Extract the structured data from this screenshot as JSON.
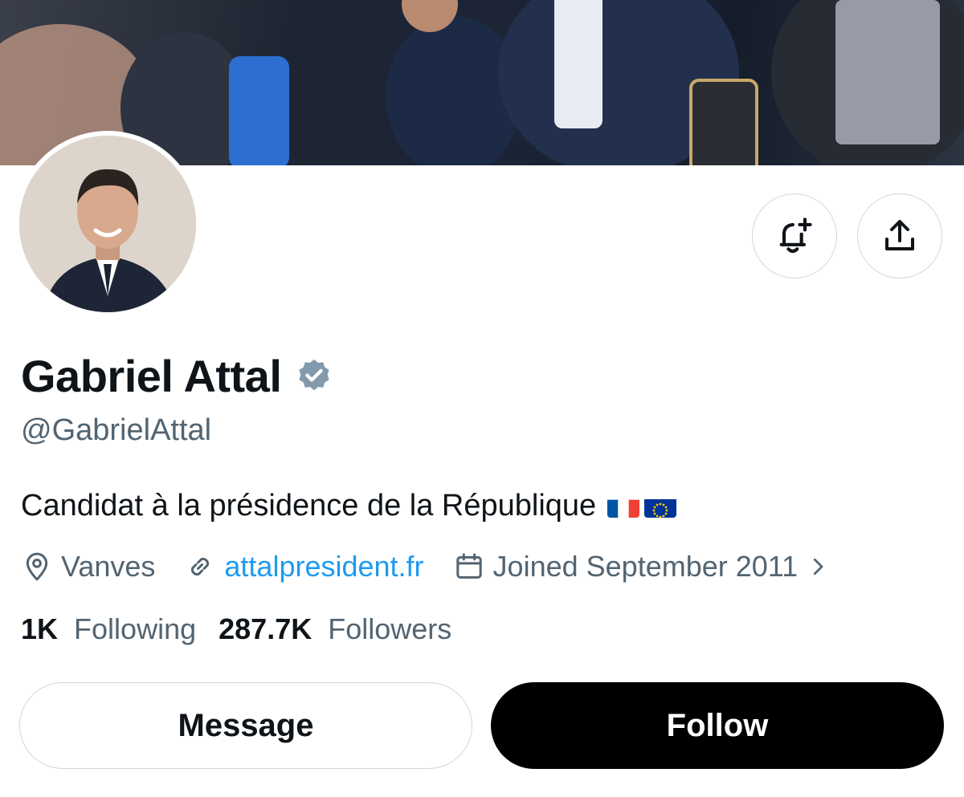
{
  "profile": {
    "name": "Gabriel Attal",
    "handle": "@GabrielAttal",
    "bio": "Candidat à la présidence de la République",
    "bio_emojis": [
      "flag-france",
      "flag-european-union"
    ],
    "location": "Vanves",
    "website": "attalpresident.fr",
    "joined": "Joined September 2011",
    "verified_badge_color": "#829aab"
  },
  "stats": {
    "following_count": "1K",
    "following_label": "Following",
    "followers_count": "287.7K",
    "followers_label": "Followers"
  },
  "actions": {
    "message_label": "Message",
    "follow_label": "Follow"
  },
  "icons": [
    "bell-plus-icon",
    "share-icon",
    "location-pin-icon",
    "link-icon",
    "calendar-icon",
    "chevron-right-icon",
    "verified-badge-icon"
  ],
  "colors": {
    "text_primary": "#0f1419",
    "text_secondary": "#536471",
    "link": "#1d9bf0",
    "follow_button": "#000000",
    "border": "#cfd9de"
  }
}
